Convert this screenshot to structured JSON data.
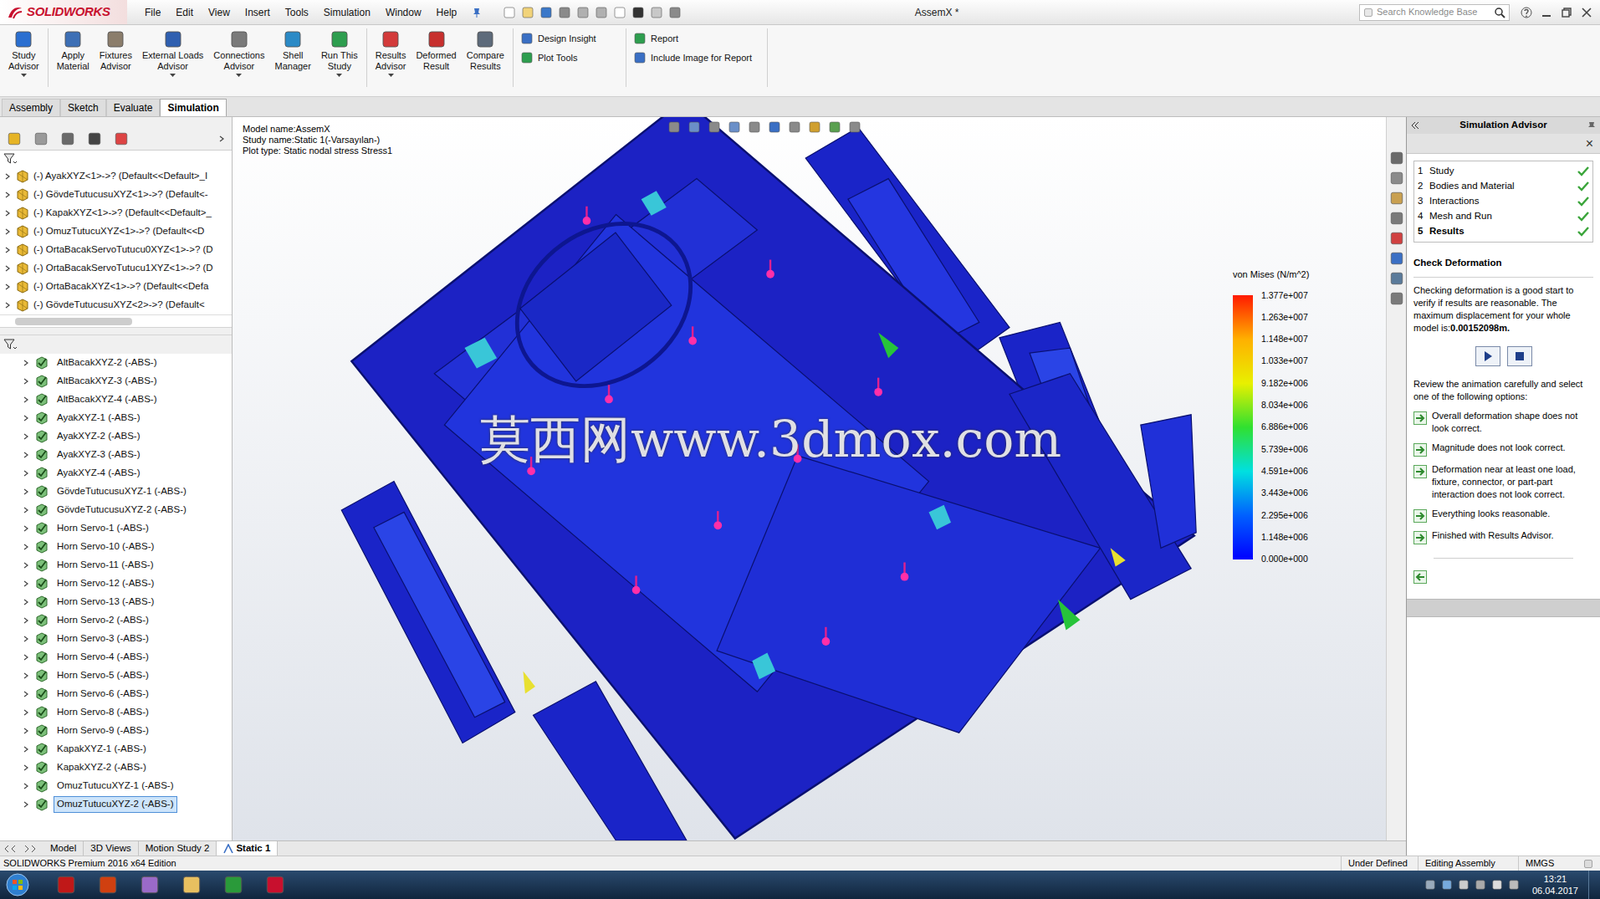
{
  "window": {
    "logo": "SOLIDWORKS",
    "title": "AssemX *",
    "search": {
      "placeholder": "Search Knowledge Base"
    }
  },
  "menu": [
    "File",
    "Edit",
    "View",
    "Insert",
    "Tools",
    "Simulation",
    "Window",
    "Help"
  ],
  "ribbon": {
    "large": [
      {
        "lines": [
          "Study",
          "Advisor"
        ]
      },
      {
        "lines": [
          "Apply",
          "Material"
        ]
      },
      {
        "lines": [
          "Fixtures",
          "Advisor"
        ]
      },
      {
        "lines": [
          "External Loads",
          "Advisor"
        ]
      },
      {
        "lines": [
          "Connections",
          "Advisor"
        ]
      },
      {
        "lines": [
          "Shell",
          "Manager"
        ]
      },
      {
        "lines": [
          "Run This",
          "Study"
        ]
      },
      {
        "lines": [
          "Results",
          "Advisor"
        ]
      },
      {
        "lines": [
          "Deformed",
          "Result"
        ]
      },
      {
        "lines": [
          "Compare",
          "Results"
        ]
      }
    ],
    "small": [
      [
        "Design Insight",
        "Plot Tools"
      ],
      [
        "Report",
        "Include Image for Report"
      ]
    ]
  },
  "tabs": [
    {
      "label": "Assembly",
      "selected": false
    },
    {
      "label": "Sketch",
      "selected": false
    },
    {
      "label": "Evaluate",
      "selected": false
    },
    {
      "label": "Simulation",
      "selected": true
    }
  ],
  "tree": {
    "items": [
      "(-) AyakXYZ<1>->? (Default<<Default>_I",
      "(-) GövdeTutucusuXYZ<1>->? (Default<-",
      "(-) KapakXYZ<1>->? (Default<<Default>_",
      "(-) OmuzTutucuXYZ<1>->? (Default<<D",
      "(-) OrtaBacakServoTutucu0XYZ<1>->? (D",
      "(-) OrtaBacakServoTutucu1XYZ<1>->? (D",
      "(-) OrtaBacakXYZ<1>->? (Default<<Defa",
      "(-) GövdeTutucusuXYZ<2>->? (Default<"
    ]
  },
  "parts": {
    "items": [
      {
        "label": "AltBacakXYZ-2 (-ABS-)",
        "selected": false
      },
      {
        "label": "AltBacakXYZ-3 (-ABS-)",
        "selected": false
      },
      {
        "label": "AltBacakXYZ-4 (-ABS-)",
        "selected": false
      },
      {
        "label": "AyakXYZ-1 (-ABS-)",
        "selected": false
      },
      {
        "label": "AyakXYZ-2 (-ABS-)",
        "selected": false
      },
      {
        "label": "AyakXYZ-3 (-ABS-)",
        "selected": false
      },
      {
        "label": "AyakXYZ-4 (-ABS-)",
        "selected": false
      },
      {
        "label": "GövdeTutucusuXYZ-1 (-ABS-)",
        "selected": false
      },
      {
        "label": "GövdeTutucusuXYZ-2 (-ABS-)",
        "selected": false
      },
      {
        "label": "Horn Servo-1 (-ABS-)",
        "selected": false
      },
      {
        "label": "Horn Servo-10 (-ABS-)",
        "selected": false
      },
      {
        "label": "Horn Servo-11 (-ABS-)",
        "selected": false
      },
      {
        "label": "Horn Servo-12 (-ABS-)",
        "selected": false
      },
      {
        "label": "Horn Servo-13 (-ABS-)",
        "selected": false
      },
      {
        "label": "Horn Servo-2 (-ABS-)",
        "selected": false
      },
      {
        "label": "Horn Servo-3 (-ABS-)",
        "selected": false
      },
      {
        "label": "Horn Servo-4 (-ABS-)",
        "selected": false
      },
      {
        "label": "Horn Servo-5 (-ABS-)",
        "selected": false
      },
      {
        "label": "Horn Servo-6 (-ABS-)",
        "selected": false
      },
      {
        "label": "Horn Servo-8 (-ABS-)",
        "selected": false
      },
      {
        "label": "Horn Servo-9 (-ABS-)",
        "selected": false
      },
      {
        "label": "KapakXYZ-1 (-ABS-)",
        "selected": false
      },
      {
        "label": "KapakXYZ-2 (-ABS-)",
        "selected": false
      },
      {
        "label": "OmuzTutucuXYZ-1 (-ABS-)",
        "selected": false
      },
      {
        "label": "OmuzTutucuXYZ-2 (-ABS-)",
        "selected": true
      }
    ]
  },
  "viewport": {
    "info": [
      "Model name:AssemX",
      "Study name:Static 1(-Varsayılan-)",
      "Plot type: Static nodal stress Stress1"
    ],
    "legend": {
      "title": "von Mises (N/m^2)",
      "ticks": [
        "1.377e+007",
        "1.263e+007",
        "1.148e+007",
        "1.033e+007",
        "9.182e+006",
        "8.034e+006",
        "6.886e+006",
        "5.739e+006",
        "4.591e+006",
        "3.443e+006",
        "2.295e+006",
        "1.148e+006",
        "0.000e+000"
      ]
    },
    "watermark": "莫西网www.3dmox.com"
  },
  "advisor": {
    "title": "Simulation Advisor",
    "close": "×",
    "steps": [
      {
        "num": "1",
        "label": "Study",
        "checked": true,
        "selected": false
      },
      {
        "num": "2",
        "label": "Bodies and Material",
        "checked": true,
        "selected": false
      },
      {
        "num": "3",
        "label": "Interactions",
        "checked": true,
        "selected": false
      },
      {
        "num": "4",
        "label": "Mesh and Run",
        "checked": true,
        "selected": false
      },
      {
        "num": "5",
        "label": "Results",
        "checked": true,
        "selected": true
      }
    ],
    "heading": "Check Deformation",
    "intro": "Checking deformation is a good start to verify if results are reasonable. The maximum displacement for your whole model is:",
    "value": "0.00152098m.",
    "review": "Review the animation carefully and select one of the following options:",
    "options": [
      "Overall deformation shape does not look correct.",
      "Magnitude does not look correct.",
      "Deformation near at least one load, fixture, connector, or part-part interaction does not look correct.",
      "Everything looks reasonable.",
      "Finished with Results Advisor."
    ]
  },
  "bottom_tabs": [
    {
      "label": "Model",
      "selected": false
    },
    {
      "label": "3D Views",
      "selected": false
    },
    {
      "label": "Motion Study 2",
      "selected": false
    },
    {
      "label": "Static 1",
      "selected": true
    }
  ],
  "status_bar": {
    "left": "SOLIDWORKS Premium 2016 x64 Edition",
    "right": [
      "Under Defined",
      "Editing Assembly",
      "MMGS"
    ]
  },
  "taskbar": {
    "time": "13:21",
    "date": "06.04.2017"
  }
}
